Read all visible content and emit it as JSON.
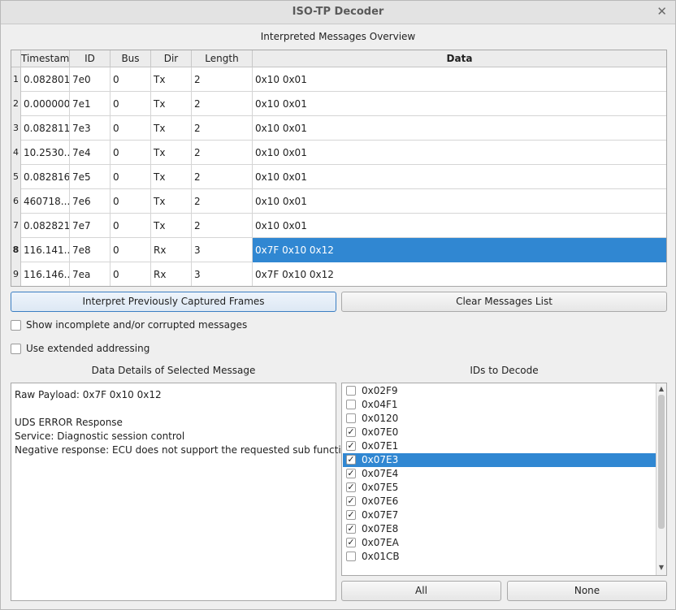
{
  "window": {
    "title": "ISO-TP Decoder",
    "close_glyph": "✕"
  },
  "overview": {
    "label": "Interpreted Messages Overview",
    "columns": [
      "Timestamp",
      "ID",
      "Bus",
      "Dir",
      "Length",
      "Data"
    ],
    "rows": [
      {
        "num": "1",
        "timestamp": "0.082801",
        "id": "7e0",
        "bus": "0",
        "dir": "Tx",
        "length": "2",
        "data": "0x10 0x01"
      },
      {
        "num": "2",
        "timestamp": "0.000000",
        "id": "7e1",
        "bus": "0",
        "dir": "Tx",
        "length": "2",
        "data": "0x10 0x01"
      },
      {
        "num": "3",
        "timestamp": "0.082811",
        "id": "7e3",
        "bus": "0",
        "dir": "Tx",
        "length": "2",
        "data": "0x10 0x01"
      },
      {
        "num": "4",
        "timestamp": "10.2530...",
        "id": "7e4",
        "bus": "0",
        "dir": "Tx",
        "length": "2",
        "data": "0x10 0x01"
      },
      {
        "num": "5",
        "timestamp": "0.082816",
        "id": "7e5",
        "bus": "0",
        "dir": "Tx",
        "length": "2",
        "data": "0x10 0x01"
      },
      {
        "num": "6",
        "timestamp": "460718...",
        "id": "7e6",
        "bus": "0",
        "dir": "Tx",
        "length": "2",
        "data": "0x10 0x01"
      },
      {
        "num": "7",
        "timestamp": "0.082821",
        "id": "7e7",
        "bus": "0",
        "dir": "Tx",
        "length": "2",
        "data": "0x10 0x01"
      },
      {
        "num": "8",
        "timestamp": "116.141...",
        "id": "7e8",
        "bus": "0",
        "dir": "Rx",
        "length": "3",
        "data": "0x7F 0x10 0x12"
      },
      {
        "num": "9",
        "timestamp": "116.146...",
        "id": "7ea",
        "bus": "0",
        "dir": "Rx",
        "length": "3",
        "data": "0x7F 0x10 0x12"
      }
    ],
    "selected_row": 8
  },
  "buttons": {
    "interpret": "Interpret Previously Captured Frames",
    "clear": "Clear Messages List",
    "all": "All",
    "none": "None"
  },
  "options": {
    "show_incomplete": {
      "label": "Show incomplete and/or corrupted messages",
      "checked": false
    },
    "extended_addressing": {
      "label": "Use extended addressing",
      "checked": false
    }
  },
  "details": {
    "label": "Data Details of Selected Message",
    "lines": [
      "Raw Payload: 0x7F 0x10 0x12",
      "",
      "UDS ERROR Response",
      "Service: Diagnostic session control",
      "Negative response: ECU does not support the requested sub function"
    ]
  },
  "ids": {
    "label": "IDs to Decode",
    "items": [
      {
        "label": "0x02F9",
        "checked": false
      },
      {
        "label": "0x04F1",
        "checked": false
      },
      {
        "label": "0x0120",
        "checked": false
      },
      {
        "label": "0x07E0",
        "checked": true
      },
      {
        "label": "0x07E1",
        "checked": true
      },
      {
        "label": "0x07E3",
        "checked": true
      },
      {
        "label": "0x07E4",
        "checked": true
      },
      {
        "label": "0x07E5",
        "checked": true
      },
      {
        "label": "0x07E6",
        "checked": true
      },
      {
        "label": "0x07E7",
        "checked": true
      },
      {
        "label": "0x07E8",
        "checked": true
      },
      {
        "label": "0x07EA",
        "checked": true
      },
      {
        "label": "0x01CB",
        "checked": false
      }
    ],
    "selected_index": 5,
    "check_glyph": "✓"
  },
  "colors": {
    "selection": "#3087d2",
    "focus_border": "#3b7ec2"
  }
}
